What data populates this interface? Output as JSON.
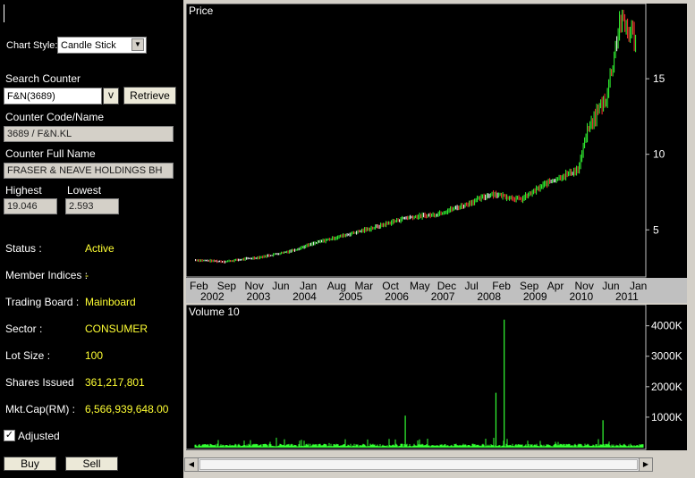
{
  "sidebar": {
    "chart_style_label": "Chart Style:",
    "chart_style_value": "Candle Stick",
    "search_label": "Search Counter",
    "search_value": "F&N(3689)",
    "search_dropdown": "v",
    "retrieve_label": "Retrieve",
    "code_label": "Counter Code/Name",
    "code_value": "3689 / F&N.KL",
    "fullname_label": "Counter Full Name",
    "fullname_value": "FRASER & NEAVE HOLDINGS BH",
    "highest_label": "Highest",
    "highest_value": "19.046",
    "lowest_label": "Lowest",
    "lowest_value": "2.593",
    "info": [
      {
        "label": "Status :",
        "value": "Active"
      },
      {
        "label": "Member Indices :",
        "value": "-"
      },
      {
        "label": "Trading Board :",
        "value": "Mainboard"
      },
      {
        "label": "Sector :",
        "value": "CONSUMER"
      },
      {
        "label": "Lot Size :",
        "value": "100"
      },
      {
        "label": "Shares Issued",
        "value": "361,217,801"
      },
      {
        "label": "Mkt.Cap(RM) :",
        "value": "6,566,939,648.00"
      }
    ],
    "adjusted_label": "Adjusted",
    "adjusted_checked": true,
    "buy_label": "Buy",
    "sell_label": "Sell"
  },
  "charts": {
    "price_title": "Price",
    "volume_title": "Volume 10",
    "x_months": [
      "Feb",
      "Sep",
      "Nov",
      "Jun",
      "Jan",
      "Aug",
      "Mar",
      "Oct",
      "May",
      "Dec",
      "Jul",
      "Feb",
      "Sep",
      "Apr",
      "Nov",
      "Jun",
      "Jan"
    ],
    "x_years": [
      "2002",
      "2003",
      "2004",
      "2005",
      "2006",
      "2007",
      "2008",
      "2009",
      "2010",
      "2011"
    ]
  },
  "chart_data": [
    {
      "type": "line",
      "title": "Price",
      "x": [
        "2002-02",
        "2002-09",
        "2003-06",
        "2004-01",
        "2004-08",
        "2005-03",
        "2005-10",
        "2006-05",
        "2006-12",
        "2007-07",
        "2008-02",
        "2008-09",
        "2009-04",
        "2009-11",
        "2010-01",
        "2010-06",
        "2010-09",
        "2011-01"
      ],
      "series": [
        {
          "values": [
            3.0,
            2.9,
            3.2,
            3.6,
            4.2,
            4.7,
            5.2,
            5.8,
            6.0,
            6.6,
            7.4,
            7.0,
            8.2,
            9.0,
            11.5,
            14.0,
            18.8,
            17.7
          ]
        }
      ],
      "y_ticks": [
        5,
        10,
        15
      ],
      "ylim": [
        2,
        19.5
      ],
      "colors": {
        "up": "#33ff33",
        "down": "#ff3333",
        "flat": "#ffffff"
      },
      "grid": false
    },
    {
      "type": "bar",
      "title": "Volume 10",
      "y_ticks": [
        "1000K",
        "2000K",
        "3000K",
        "4000K"
      ],
      "ylim": [
        0,
        4400
      ],
      "spikes": [
        {
          "x": "2006-05",
          "value": 1050
        },
        {
          "x": "2008-03",
          "value": 1800
        },
        {
          "x": "2008-05",
          "value": 4200
        },
        {
          "x": "2010-05",
          "value": 900
        }
      ],
      "color": "#33ff33"
    }
  ]
}
